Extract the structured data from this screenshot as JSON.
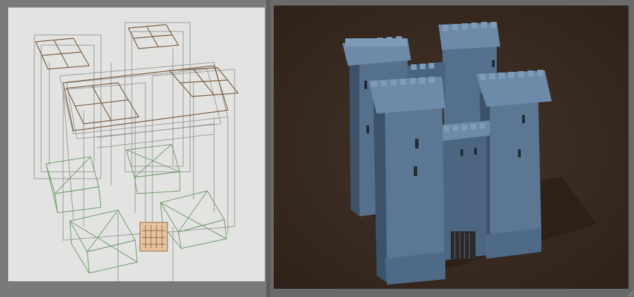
{
  "left_view": {
    "mode": "wireframe",
    "background": "#e4e4e2",
    "edge_colors": {
      "structure": "#8e8e8e",
      "floor_grid": "#7a5a3c",
      "base_boxes": "#6d9a6a",
      "gate": "#c99a6a"
    }
  },
  "right_view": {
    "mode": "shaded",
    "background": "#3a2c20",
    "stone_colors": {
      "light": "#6d8aa8",
      "mid": "#55708d",
      "dark": "#3c526b"
    },
    "gate_color": "#2a2a2a"
  },
  "window": {
    "separator_color": "#5e5e5e"
  }
}
